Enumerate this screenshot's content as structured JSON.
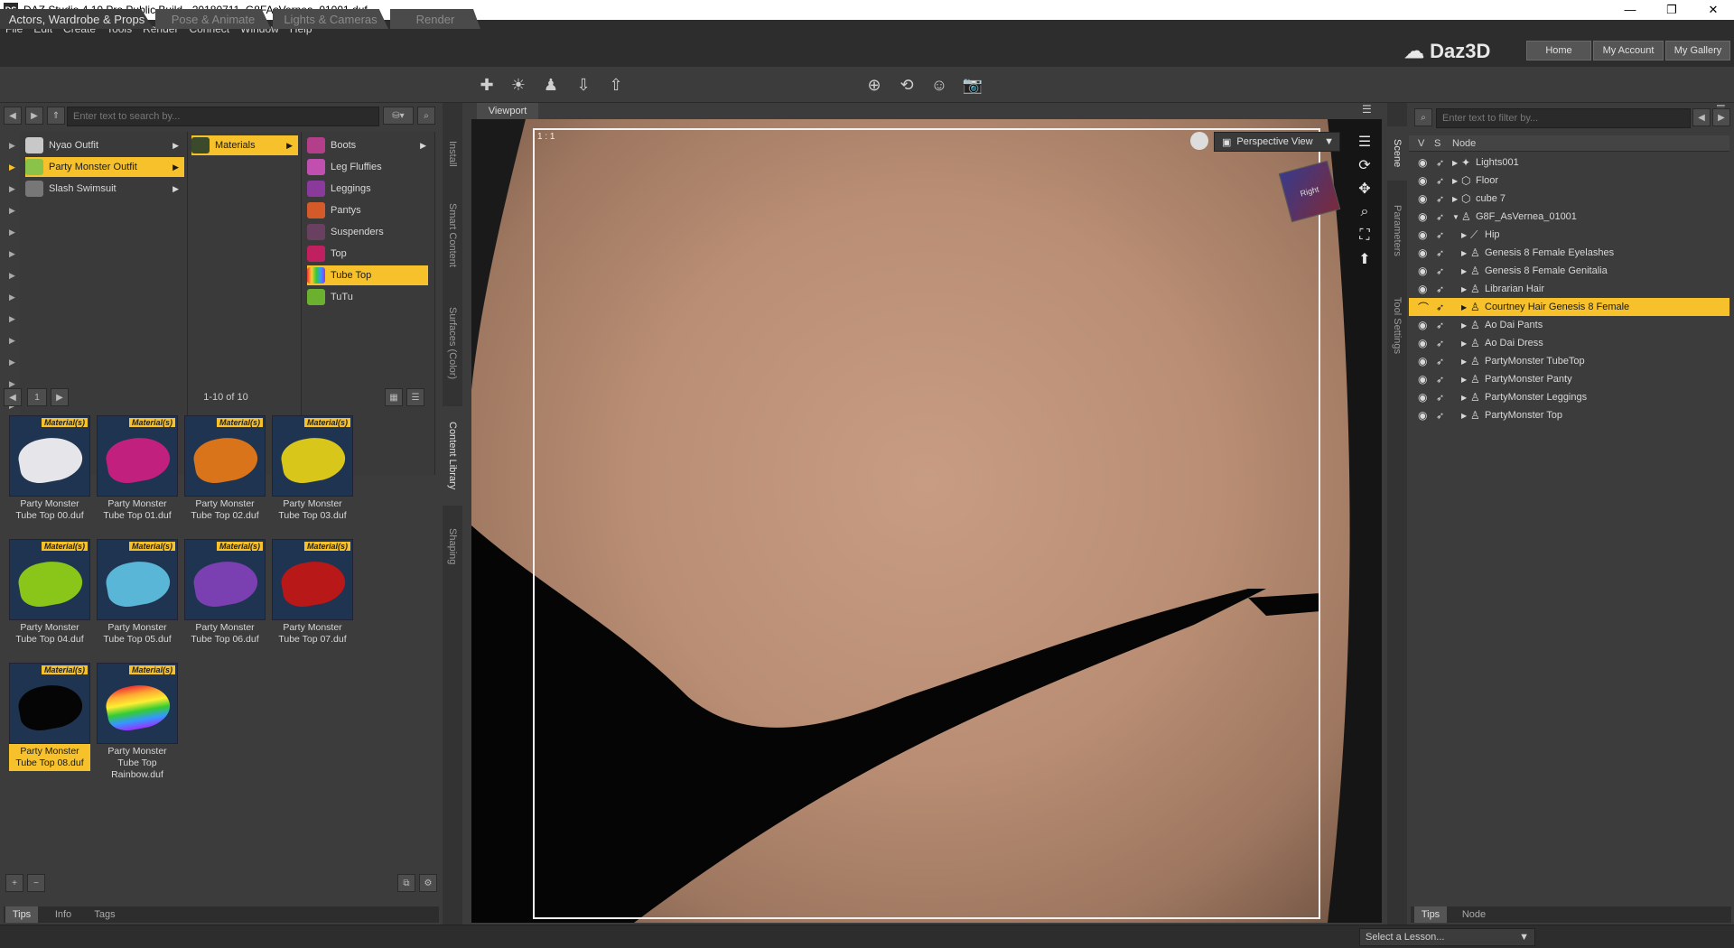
{
  "window": {
    "title": "DAZ Studio 4.10 Pro Public Build - 20180711_G8FAsVernea_01001.duf",
    "app_icon": "DS",
    "controls": [
      "—",
      "❐",
      "✕"
    ]
  },
  "menu": [
    "File",
    "Edit",
    "Create",
    "Tools",
    "Render",
    "Connect",
    "Window",
    "Help"
  ],
  "workspace_tabs": [
    "Actors, Wardrobe & Props",
    "Pose & Animate",
    "Lights & Cameras",
    "Render"
  ],
  "brand": {
    "logo_text": "Daz3D",
    "buttons": [
      "Home",
      "My Account",
      "My Gallery"
    ]
  },
  "content_library": {
    "search_placeholder": "Enter text to search by...",
    "col1": [
      {
        "label": "Nyao Outfit",
        "selected": false
      },
      {
        "label": "Party Monster Outfit",
        "selected": true
      },
      {
        "label": "Slash Swimsuit",
        "selected": false
      }
    ],
    "col2": [
      {
        "label": "Materials",
        "selected": true
      }
    ],
    "col3": [
      {
        "label": "Boots",
        "selected": false
      },
      {
        "label": "Leg Fluffies",
        "selected": false
      },
      {
        "label": "Leggings",
        "selected": false
      },
      {
        "label": "Pantys",
        "selected": false
      },
      {
        "label": "Suspenders",
        "selected": false
      },
      {
        "label": "Top",
        "selected": false
      },
      {
        "label": "Tube Top",
        "selected": true
      },
      {
        "label": "TuTu",
        "selected": false
      }
    ],
    "page": "1",
    "range": "1-10 of 10",
    "badge": "Material(s)",
    "items": [
      {
        "caption": "Party Monster Tube Top 00.duf",
        "color": "#e6e6ea",
        "selected": false
      },
      {
        "caption": "Party Monster Tube Top 01.duf",
        "color": "#c2207e",
        "selected": false
      },
      {
        "caption": "Party Monster Tube Top 02.duf",
        "color": "#d9741a",
        "selected": false
      },
      {
        "caption": "Party Monster Tube Top 03.duf",
        "color": "#d9c61a",
        "selected": false
      },
      {
        "caption": "Party Monster Tube Top 04.duf",
        "color": "#8ac51a",
        "selected": false
      },
      {
        "caption": "Party Monster Tube Top 05.duf",
        "color": "#5ab6d6",
        "selected": false
      },
      {
        "caption": "Party Monster Tube Top 06.duf",
        "color": "#7a3fb0",
        "selected": false
      },
      {
        "caption": "Party Monster Tube Top 07.duf",
        "color": "#b81818",
        "selected": false
      },
      {
        "caption": "Party Monster Tube Top 08.duf",
        "color": "#050505",
        "selected": true
      },
      {
        "caption": "Party Monster Tube Top Rainbow.duf",
        "color": "rainbow",
        "selected": false
      }
    ],
    "bottom_tabs": [
      "Tips",
      "Info",
      "Tags"
    ]
  },
  "left_vtabs": [
    "Install",
    "Smart Content",
    "Surfaces (Color)",
    "Content Library",
    "Shaping"
  ],
  "viewport": {
    "tab": "Viewport",
    "ratio": "1 : 1",
    "view_mode": "Perspective View",
    "cube_label": "Right"
  },
  "right_vtabs": [
    "Scene",
    "Parameters",
    "Tool Settings"
  ],
  "scene": {
    "filter_placeholder": "Enter text to filter by...",
    "columns": [
      "V",
      "S",
      "Node"
    ],
    "nodes": [
      {
        "label": "Lights001",
        "depth": 0,
        "icon": "light",
        "expanded": false,
        "selected": false
      },
      {
        "label": "Floor",
        "depth": 0,
        "icon": "prop",
        "expanded": false,
        "selected": false
      },
      {
        "label": "cube 7",
        "depth": 0,
        "icon": "prop",
        "expanded": false,
        "selected": false
      },
      {
        "label": "G8F_AsVernea_01001",
        "depth": 0,
        "icon": "figure",
        "expanded": true,
        "selected": false
      },
      {
        "label": "Hip",
        "depth": 1,
        "icon": "bone",
        "expanded": false,
        "selected": false
      },
      {
        "label": "Genesis 8 Female Eyelashes",
        "depth": 1,
        "icon": "figure",
        "expanded": false,
        "selected": false
      },
      {
        "label": "Genesis 8 Female Genitalia",
        "depth": 1,
        "icon": "figure",
        "expanded": false,
        "selected": false
      },
      {
        "label": "Librarian Hair",
        "depth": 1,
        "icon": "figure",
        "expanded": false,
        "selected": false
      },
      {
        "label": "Courtney Hair Genesis 8 Female",
        "depth": 1,
        "icon": "figure",
        "expanded": false,
        "selected": true
      },
      {
        "label": "Ao Dai Pants",
        "depth": 1,
        "icon": "figure",
        "expanded": false,
        "selected": false
      },
      {
        "label": "Ao Dai Dress",
        "depth": 1,
        "icon": "figure",
        "expanded": false,
        "selected": false
      },
      {
        "label": "PartyMonster TubeTop",
        "depth": 1,
        "icon": "figure",
        "expanded": false,
        "selected": false
      },
      {
        "label": "PartyMonster Panty",
        "depth": 1,
        "icon": "figure",
        "expanded": false,
        "selected": false
      },
      {
        "label": "PartyMonster Leggings",
        "depth": 1,
        "icon": "figure",
        "expanded": false,
        "selected": false
      },
      {
        "label": "PartyMonster Top",
        "depth": 1,
        "icon": "figure",
        "expanded": false,
        "selected": false
      }
    ],
    "bottom_tabs": [
      "Tips",
      "Node"
    ]
  },
  "status": {
    "lesson": "Select a Lesson..."
  },
  "colors": {
    "accent": "#f6c12a",
    "panel": "#3c3c3c",
    "dark": "#2d2d2d"
  }
}
